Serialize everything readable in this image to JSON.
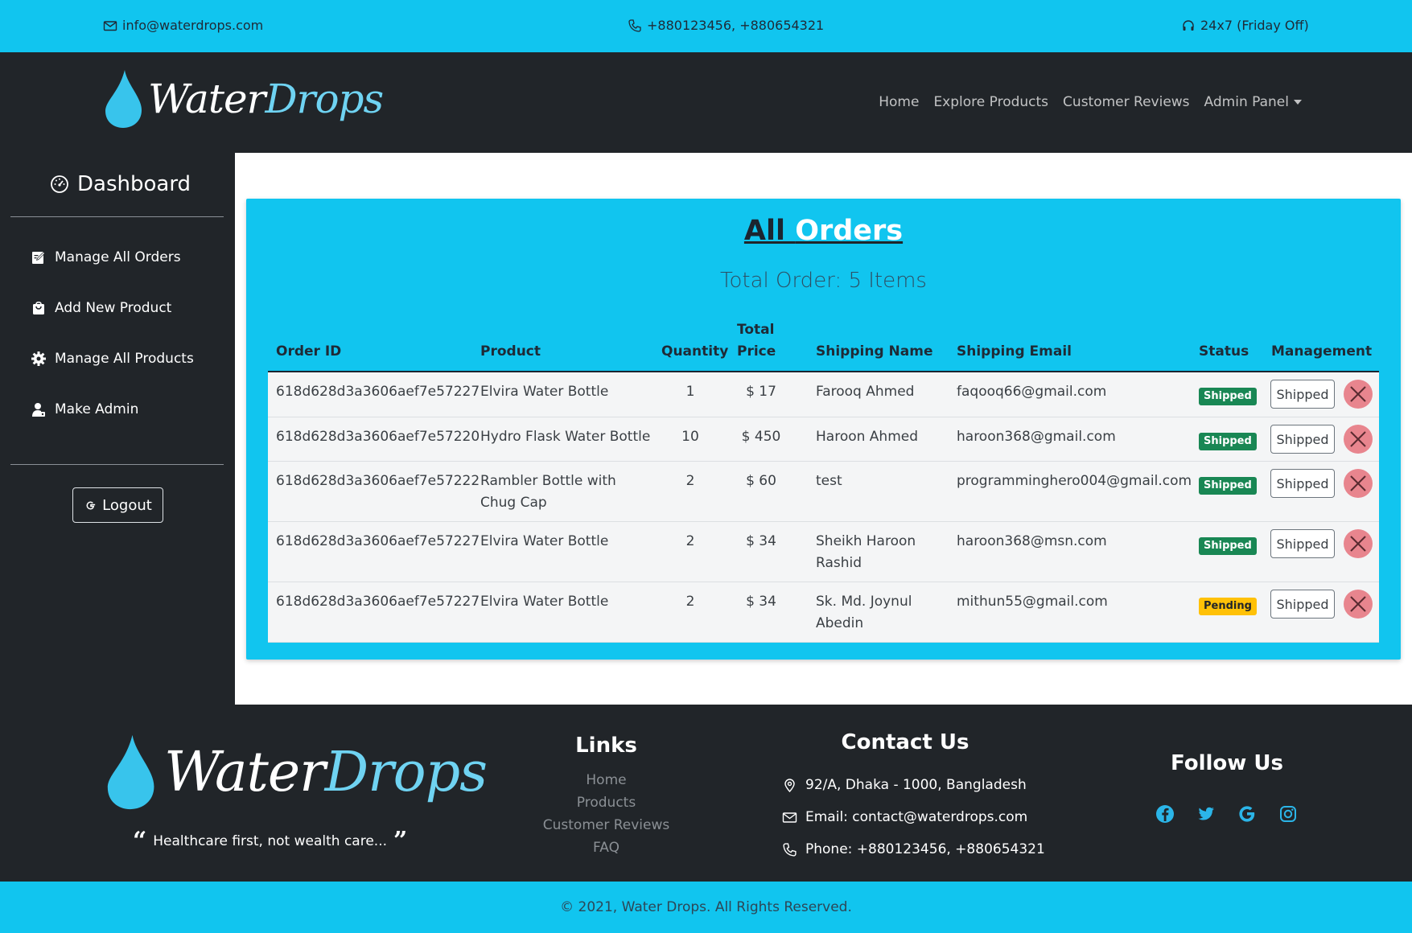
{
  "topbar": {
    "email": "info@waterdrops.com",
    "phone": "+880123456, +880654321",
    "hours": "24x7 (Friday Off)"
  },
  "brand": {
    "name_part1": "Water",
    "name_part2": "Drops"
  },
  "nav": {
    "items": [
      "Home",
      "Explore Products",
      "Customer Reviews"
    ],
    "admin_label": "Admin Panel"
  },
  "sidebar": {
    "title": "Dashboard",
    "items": [
      {
        "label": "Manage All Orders",
        "icon": "edit-icon"
      },
      {
        "label": "Add New Product",
        "icon": "bag-icon"
      },
      {
        "label": "Manage All Products",
        "icon": "gear-icon"
      },
      {
        "label": "Make Admin",
        "icon": "user-icon"
      }
    ],
    "logout_label": "Logout"
  },
  "orders": {
    "title_word1": "All",
    "title_word2": "Orders",
    "total_line": "Total Order: 5 Items",
    "columns": {
      "order_id": "Order ID",
      "product": "Product",
      "quantity": "Quantity",
      "total_price_line1": "Total",
      "total_price_line2": "Price",
      "shipping_name": "Shipping Name",
      "shipping_email": "Shipping Email",
      "status": "Status",
      "management": "Management"
    },
    "ship_button_label": "Shipped",
    "rows": [
      {
        "id": "618d628d3a3606aef7e57227",
        "product": [
          "Elvira Water Bottle"
        ],
        "qty": "1",
        "price": "$ 17",
        "name": [
          "Farooq Ahmed"
        ],
        "email": "faqooq66@gmail.com",
        "status": "Shipped"
      },
      {
        "id": "618d628d3a3606aef7e57220",
        "product": [
          "Hydro Flask Water Bottle"
        ],
        "qty": "10",
        "price": "$ 450",
        "name": [
          "Haroon Ahmed"
        ],
        "email": "haroon368@gmail.com",
        "status": "Shipped"
      },
      {
        "id": "618d628d3a3606aef7e57222",
        "product": [
          "Rambler Bottle with",
          "Chug Cap"
        ],
        "qty": "2",
        "price": "$ 60",
        "name": [
          "test"
        ],
        "email": "programminghero004@gmail.com",
        "status": "Shipped"
      },
      {
        "id": "618d628d3a3606aef7e57227",
        "product": [
          "Elvira Water Bottle"
        ],
        "qty": "2",
        "price": "$ 34",
        "name": [
          "Sheikh Haroon",
          "Rashid"
        ],
        "email": "haroon368@msn.com",
        "status": "Shipped"
      },
      {
        "id": "618d628d3a3606aef7e57227",
        "product": [
          "Elvira Water Bottle"
        ],
        "qty": "2",
        "price": "$ 34",
        "name": [
          "Sk. Md. Joynul",
          "Abedin"
        ],
        "email": "mithun55@gmail.com",
        "status": "Pending"
      }
    ]
  },
  "footer": {
    "tagline": "Healthcare first, not wealth care...",
    "links_title": "Links",
    "links": [
      "Home",
      "Products",
      "Customer Reviews",
      "FAQ"
    ],
    "contact_title": "Contact Us",
    "address": "92/A, Dhaka - 1000, Bangladesh",
    "email": "Email: contact@waterdrops.com",
    "phone": "Phone: +880123456, +880654321",
    "follow_title": "Follow Us",
    "social": [
      "facebook-icon",
      "twitter-icon",
      "google-icon",
      "instagram-icon"
    ],
    "copyright": "© 2021, Water Drops. All Rights Reserved."
  },
  "colors": {
    "accent": "#11c5ef",
    "dark": "#212529",
    "shipped": "#198754",
    "pending": "#ffc107",
    "delete": "#e8858e",
    "social": "#2bb5e8"
  }
}
